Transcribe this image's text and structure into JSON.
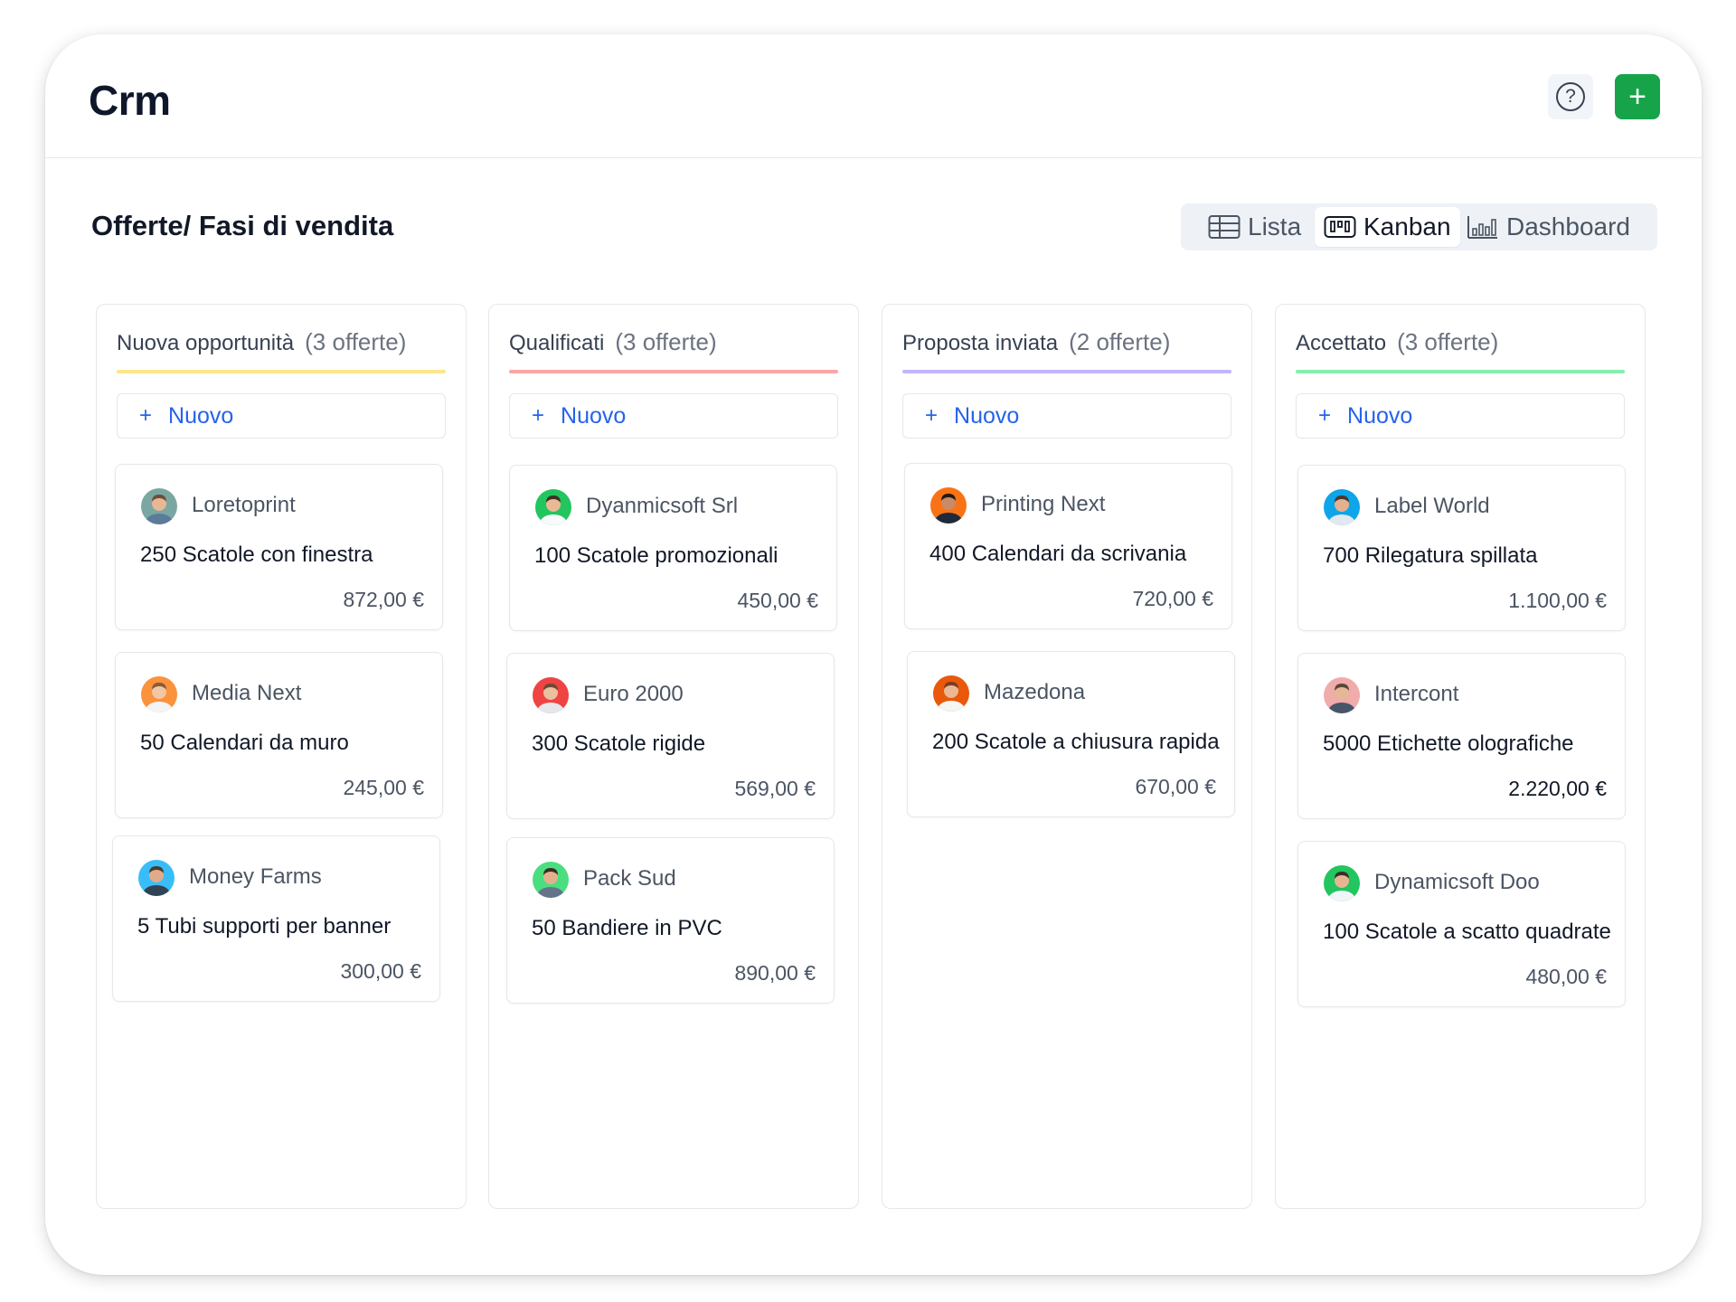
{
  "app": {
    "title": "Crm",
    "help_icon": "question-circle-icon",
    "add_icon": "plus-icon",
    "add_color": "#16a34a"
  },
  "page": {
    "title": "Offerte/ Fasi di vendita"
  },
  "views": [
    {
      "label": "Lista",
      "icon": "table-icon",
      "active": false
    },
    {
      "label": "Kanban",
      "icon": "kanban-icon",
      "active": true
    },
    {
      "label": "Dashboard",
      "icon": "bar-chart-icon",
      "active": false
    }
  ],
  "new_label": "Nuovo",
  "new_plus": "+",
  "columns": [
    {
      "name": "Nuova opportunità",
      "count": "(3 offerte)",
      "color": "#fde68a",
      "cards": [
        {
          "company": "Loretoprint",
          "deal": "250 Scatole con finestra",
          "amount": "872,00 €",
          "avatar_bg": "#7ba7a3",
          "skin": "#e8b795",
          "hair": "#6b4f3a",
          "shirt": "#5b7c99"
        },
        {
          "company": "Media Next",
          "deal": "50 Calendari da muro",
          "amount": "245,00 €",
          "avatar_bg": "#fb923c",
          "skin": "#f1c7a6",
          "hair": "#8a5a3b",
          "shirt": "#f3f4f6"
        },
        {
          "company": "Money Farms",
          "deal": "5 Tubi supporti per banner",
          "amount": "300,00 €",
          "avatar_bg": "#38bdf8",
          "skin": "#e0ac88",
          "hair": "#4b3b30",
          "shirt": "#334155"
        }
      ]
    },
    {
      "name": "Qualificati",
      "count": "(3 offerte)",
      "color": "#fca5a5",
      "cards": [
        {
          "company": "Dyanmicsoft Srl",
          "deal": "100 Scatole promozionali",
          "amount": "450,00 €",
          "avatar_bg": "#22c55e",
          "skin": "#e9b996",
          "hair": "#3f2f26",
          "shirt": "#f8fafc"
        },
        {
          "company": "Euro 2000",
          "deal": "300 Scatole rigide",
          "amount": "569,00 €",
          "avatar_bg": "#ef4444",
          "skin": "#ecc09f",
          "hair": "#6b4a34",
          "shirt": "#e5e7eb"
        },
        {
          "company": "Pack Sud",
          "deal": "50 Bandiere in PVC",
          "amount": "890,00 €",
          "avatar_bg": "#4ade80",
          "skin": "#e3b08e",
          "hair": "#3b2e24",
          "shirt": "#64748b"
        }
      ]
    },
    {
      "name": "Proposta inviata",
      "count": "(2 offerte)",
      "color": "#c4b5fd",
      "cards": [
        {
          "company": "Printing Next",
          "deal": "400 Calendari da scrivania",
          "amount": "720,00 €",
          "avatar_bg": "#f97316",
          "skin": "#c98b66",
          "hair": "#1f1a17",
          "shirt": "#1e293b"
        },
        {
          "company": "Mazedona",
          "deal": "200 Scatole a chiusura rapida",
          "amount": "670,00 €",
          "avatar_bg": "#ea580c",
          "skin": "#eab893",
          "hair": "#7a3e22",
          "shirt": "#f5f5f4"
        }
      ]
    },
    {
      "name": "Accettato",
      "count": "(3 offerte)",
      "color": "#86efac",
      "cards": [
        {
          "company": "Label World",
          "deal": "700 Rilegatura spillata",
          "amount": "1.100,00 €",
          "avatar_bg": "#0ea5e9",
          "skin": "#e4b18f",
          "hair": "#4a382c",
          "shirt": "#e2e8f0"
        },
        {
          "company": "Intercont",
          "deal": "5000 Etichette olografiche",
          "amount": "2.220,00 €",
          "avatar_bg": "#f0abab",
          "skin": "#e6b697",
          "hair": "#5c4637",
          "shirt": "#475569"
        },
        {
          "company": "Dynamicsoft Doo",
          "deal": "100 Scatole a scatto quadrate",
          "amount": "480,00 €",
          "avatar_bg": "#22c55e",
          "skin": "#e7b592",
          "hair": "#3c2f26",
          "shirt": "#f1f5f9"
        }
      ]
    }
  ]
}
